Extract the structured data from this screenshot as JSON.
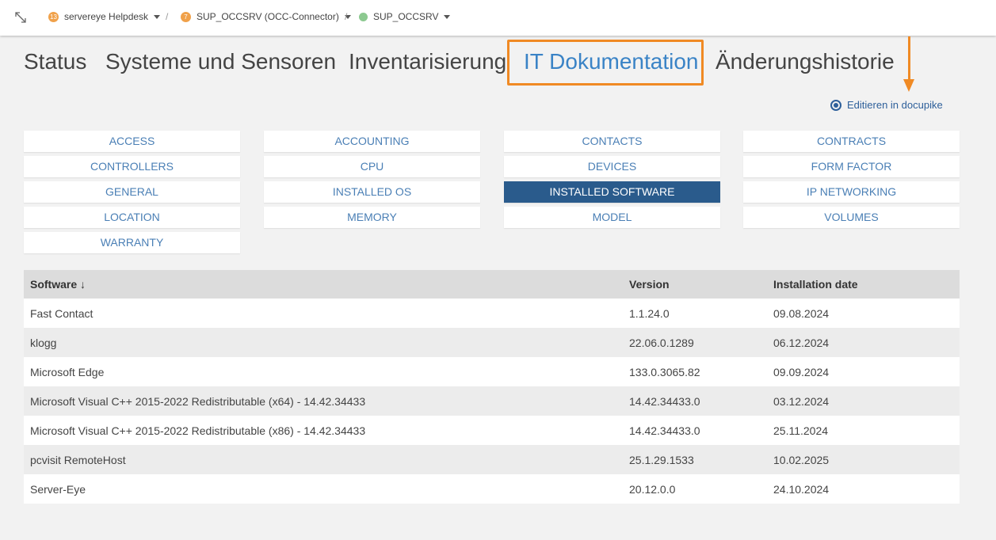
{
  "breadcrumb": [
    {
      "badge": "13",
      "label": "servereye Helpdesk"
    },
    {
      "badge": "7",
      "label": "SUP_OCCSRV (OCC-Connector)"
    },
    {
      "label": "SUP_OCCSRV"
    }
  ],
  "nav_tabs": [
    "Status",
    "Systeme und Sensoren",
    "Inventarisierung",
    "IT Dokumentation",
    "Änderungshistorie"
  ],
  "active_tab": "IT Dokumentation",
  "edit_link": "Editieren in docupike",
  "categories": [
    [
      "ACCESS",
      "ACCOUNTING",
      "CONTACTS",
      "CONTRACTS"
    ],
    [
      "CONTROLLERS",
      "CPU",
      "DEVICES",
      "FORM FACTOR"
    ],
    [
      "GENERAL",
      "INSTALLED OS",
      "INSTALLED SOFTWARE",
      "IP NETWORKING"
    ],
    [
      "LOCATION",
      "MEMORY",
      "MODEL",
      "VOLUMES"
    ],
    [
      "WARRANTY"
    ]
  ],
  "active_category": "INSTALLED SOFTWARE",
  "table": {
    "headers": [
      "Software ↓",
      "Version",
      "Installation date"
    ],
    "rows": [
      [
        "Fast Contact",
        "1.1.24.0",
        "09.08.2024"
      ],
      [
        "klogg",
        "22.06.0.1289",
        "06.12.2024"
      ],
      [
        "Microsoft Edge",
        "133.0.3065.82",
        "09.09.2024"
      ],
      [
        "Microsoft Visual C++ 2015-2022 Redistributable (x64) - 14.42.34433",
        "14.42.34433.0",
        "03.12.2024"
      ],
      [
        "Microsoft Visual C++ 2015-2022 Redistributable (x86) - 14.42.34433",
        "14.42.34433.0",
        "25.11.2024"
      ],
      [
        "pcvisit RemoteHost",
        "25.1.29.1533",
        "10.02.2025"
      ],
      [
        "Server-Eye",
        "20.12.0.0",
        "24.10.2024"
      ]
    ]
  },
  "colors": {
    "accent": "#3a83c6",
    "active_button": "#2a5b8c",
    "highlight": "#f08a24"
  }
}
